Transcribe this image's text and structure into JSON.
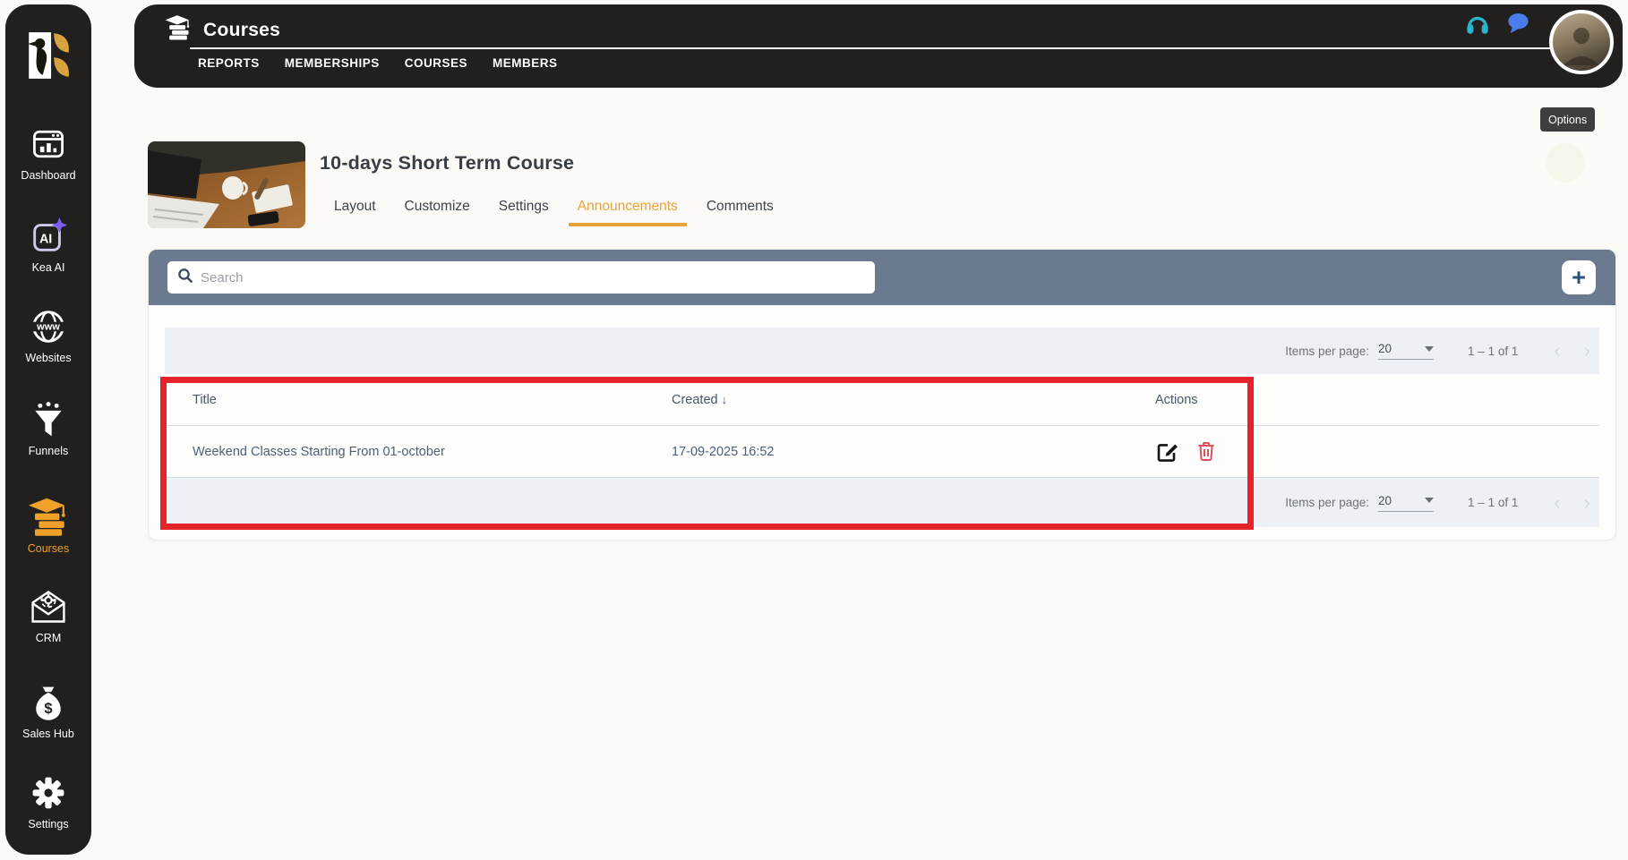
{
  "colors": {
    "dark_panel": "#21201e",
    "accent_orange": "#efa12c",
    "toolbar_slate": "#6b7a8f",
    "highlight_red": "#e6232a",
    "headset_teal": "#2ab5cd",
    "chat_blue": "#4b7cec",
    "sparkle_purple": "#7e5ef2",
    "trash_red": "#dc4f5c"
  },
  "sidebar": {
    "logo_icon": "kea-bird-logo",
    "items": [
      {
        "label": "Dashboard",
        "icon": "dashboard-icon",
        "active": false
      },
      {
        "label": "Kea AI",
        "icon": "kea-ai-icon",
        "active": false
      },
      {
        "label": "Websites",
        "icon": "websites-globe-icon",
        "active": false
      },
      {
        "label": "Funnels",
        "icon": "funnel-icon",
        "active": false
      },
      {
        "label": "Courses",
        "icon": "courses-books-icon",
        "active": true
      },
      {
        "label": "CRM",
        "icon": "crm-envelope-gear-icon",
        "active": false
      },
      {
        "label": "Sales Hub",
        "icon": "money-bag-icon",
        "active": false
      },
      {
        "label": "Settings",
        "icon": "gear-icon",
        "active": false
      }
    ]
  },
  "header": {
    "title": "Courses",
    "title_icon": "courses-books-icon",
    "nav": [
      {
        "label": "REPORTS"
      },
      {
        "label": "MEMBERSHIPS"
      },
      {
        "label": "COURSES"
      },
      {
        "label": "MEMBERS"
      }
    ],
    "right_icons": [
      "headset-icon",
      "chat-bubble-icon",
      "user-avatar"
    ]
  },
  "tooltip": {
    "label": "Options"
  },
  "course": {
    "title": "10-days Short Term Course",
    "thumbnail": "desk-with-laptop-photo",
    "tabs": [
      {
        "label": "Layout",
        "active": false
      },
      {
        "label": "Customize",
        "active": false
      },
      {
        "label": "Settings",
        "active": false
      },
      {
        "label": "Announcements",
        "active": true
      },
      {
        "label": "Comments",
        "active": false
      }
    ]
  },
  "toolbar": {
    "search_placeholder": "Search",
    "search_value": "",
    "add_label": "+"
  },
  "pagination": {
    "items_per_page_label": "Items per page:",
    "items_per_page": "20",
    "range": "1 – 1 of 1",
    "prev_icon": "‹",
    "next_icon": "›"
  },
  "table": {
    "columns": {
      "title": "Title",
      "created": "Created",
      "actions": "Actions"
    },
    "sort_icon": "↓",
    "rows": [
      {
        "title": "Weekend Classes Starting From 01-october",
        "created": "17-09-2025 16:52"
      }
    ]
  }
}
